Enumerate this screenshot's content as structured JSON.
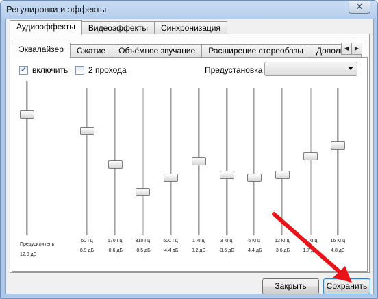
{
  "window": {
    "title": "Регулировки и эффекты",
    "close_glyph": "✕"
  },
  "outer_tabs": [
    "Аудиоэффекты",
    "Видеоэффекты",
    "Синхронизация"
  ],
  "inner_tabs": [
    "Эквалайзер",
    "Сжатие",
    "Объёмное звучание",
    "Расширение стереобазы",
    "Дополните"
  ],
  "scroll": {
    "left": "◀",
    "right": "▶"
  },
  "equalizer": {
    "enable_label": "включить",
    "enable_checked": true,
    "two_pass_label": "2 прохода",
    "two_pass_checked": false,
    "preset_label": "Предустановка",
    "preset_value": "",
    "preamp": {
      "label": "Предусилитель",
      "value": "12.0 дБ",
      "level_db": 12.0
    },
    "bands": [
      {
        "freq": "60 Гц",
        "value": "8.9 дБ",
        "level_db": 8.9
      },
      {
        "freq": "170 Гц",
        "value": "-0.6 дБ",
        "level_db": -0.6
      },
      {
        "freq": "310 Гц",
        "value": "-8.5 дБ",
        "level_db": -8.5
      },
      {
        "freq": "600 Гц",
        "value": "-4.4 дБ",
        "level_db": -4.4
      },
      {
        "freq": "1 КГц",
        "value": "0.2 дБ",
        "level_db": 0.2
      },
      {
        "freq": "3 КГц",
        "value": "-3.6 дБ",
        "level_db": -3.6
      },
      {
        "freq": "6 КГц",
        "value": "-4.4 дБ",
        "level_db": -4.4
      },
      {
        "freq": "12 КГц",
        "value": "-3.6 дБ",
        "level_db": -3.6
      },
      {
        "freq": "14 КГц",
        "value": "1.7 дБ",
        "level_db": 1.7
      },
      {
        "freq": "16 КГц",
        "value": "4.8 дБ",
        "level_db": 4.8
      }
    ],
    "range_db": [
      -20,
      20
    ]
  },
  "buttons": {
    "close": "Закрыть",
    "save": "Сохранить"
  },
  "annotation": {
    "arrow_color": "#e8141a"
  }
}
